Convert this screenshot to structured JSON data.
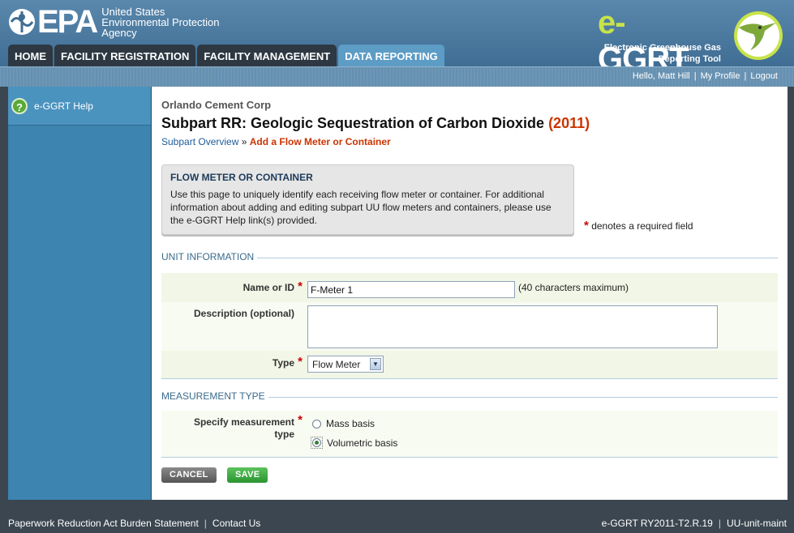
{
  "header": {
    "epa_word": "EPA",
    "epa_agency_line1": "United States",
    "epa_agency_line2": "Environmental Protection",
    "epa_agency_line3": "Agency",
    "app_logo_prefix": "e-",
    "app_logo_name": "GGRT",
    "app_tagline_line1": "Electronic Greenhouse Gas",
    "app_tagline_line2": "Reporting Tool",
    "tabs": [
      {
        "label": "HOME",
        "active": false
      },
      {
        "label": "FACILITY REGISTRATION",
        "active": false
      },
      {
        "label": "FACILITY MANAGEMENT",
        "active": false
      },
      {
        "label": "DATA REPORTING",
        "active": true
      }
    ]
  },
  "userbar": {
    "greeting": "Hello, Matt Hill",
    "profile": "My Profile",
    "logout": "Logout"
  },
  "sidebar": {
    "help_icon": "?",
    "help_label": "e-GGRT Help"
  },
  "main": {
    "facility_name": "Orlando Cement Corp",
    "title": "Subpart RR: Geologic Sequestration of Carbon Dioxide",
    "year": "(2011)",
    "breadcrumb_link": "Subpart Overview",
    "breadcrumb_sep": " » ",
    "breadcrumb_current": "Add a Flow Meter or Container",
    "info_title": "FLOW METER OR CONTAINER",
    "info_text": "Use this page to uniquely identify each receiving flow meter or container. For additional information about adding and editing subpart UU flow meters and containers, please use the e-GGRT Help link(s) provided.",
    "required_marker": "*",
    "required_note": "denotes a required field"
  },
  "unit_info": {
    "section_title": "UNIT INFORMATION",
    "name_label": "Name or ID",
    "name_value": "F-Meter 1",
    "name_hint": "(40 characters maximum)",
    "desc_label": "Description (optional)",
    "desc_value": "",
    "type_label": "Type",
    "type_value": "Flow Meter"
  },
  "measurement": {
    "section_title": "MEASUREMENT TYPE",
    "label_line1": "Specify measurement",
    "label_line2": "type",
    "options": [
      {
        "label": "Mass basis",
        "selected": false
      },
      {
        "label": "Volumetric basis",
        "selected": true
      }
    ]
  },
  "buttons": {
    "cancel": "CANCEL",
    "save": "SAVE"
  },
  "footer": {
    "paperwork": "Paperwork Reduction Act Burden Statement",
    "contact": "Contact Us",
    "version": "e-GGRT RY2011-T2.R.19",
    "page_id": "UU-unit-maint"
  },
  "colors": {
    "header_blue": "#4a7ba2",
    "active_tab": "#5c9cc5",
    "sidebar": "#3d84b0",
    "accent_red": "#cc3300",
    "save_green": "#2a9430"
  },
  "icons": [
    "epa-logo-icon",
    "egg-bird-icon",
    "help-icon",
    "select-arrow-icon"
  ]
}
